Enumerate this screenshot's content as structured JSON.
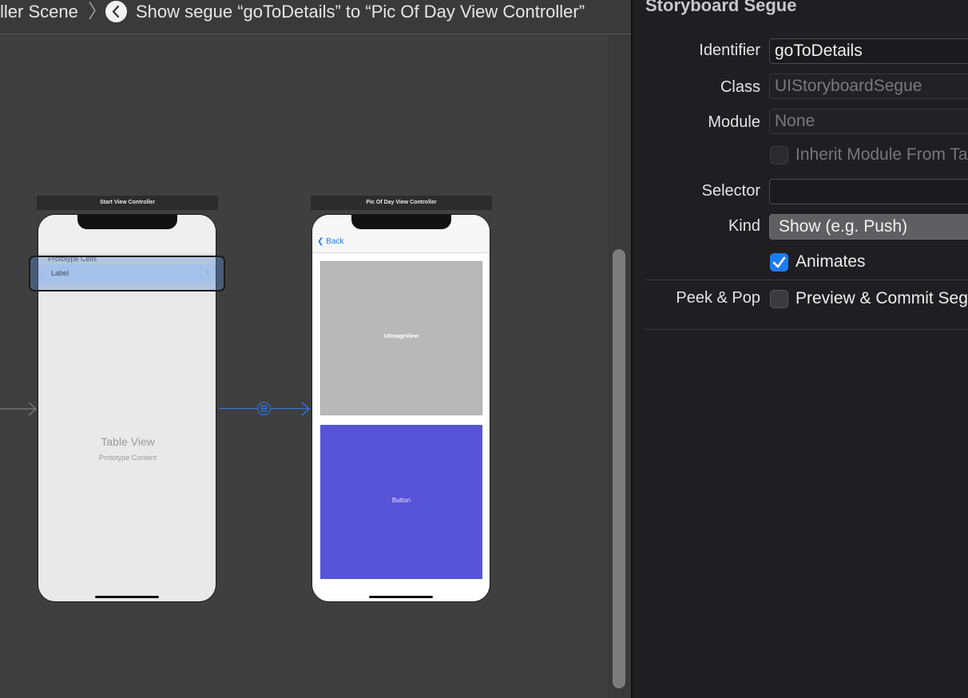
{
  "jumpbar": {
    "scene_text": "ller Scene",
    "separator": "〉",
    "segue_text": "Show segue “goToDetails” to “Pic Of Day View Controller”"
  },
  "canvas": {
    "start_vc": {
      "title": "Start View Controller",
      "prototype_cells": "Prototype Cells",
      "cell_label": "Label",
      "table_view": "Table View",
      "prototype_content": "Prototype Content"
    },
    "pic_vc": {
      "title": "Pic Of Day View Controller",
      "back_label": "Back",
      "image_view_label": "UIImageView",
      "button_label": "Button"
    }
  },
  "inspector": {
    "title": "Storyboard Segue",
    "identifier": {
      "label": "Identifier",
      "value": "goToDetails"
    },
    "class": {
      "label": "Class",
      "placeholder": "UIStoryboardSegue"
    },
    "module": {
      "label": "Module",
      "placeholder": "None"
    },
    "inherit_module": {
      "label": "Inherit Module From Target",
      "checked": false
    },
    "selector": {
      "label": "Selector",
      "value": ""
    },
    "kind": {
      "label": "Kind",
      "value": "Show (e.g. Push)"
    },
    "animates": {
      "label": "Animates",
      "checked": true
    },
    "peek_pop": {
      "label": "Peek & Pop",
      "option": "Preview & Commit Segues",
      "checked": false
    }
  },
  "colors": {
    "accent": "#1e7cf2",
    "button_bg": "#5753d8",
    "image_view_bg": "#b8b8b8",
    "segue_line": "#2f7be8"
  }
}
